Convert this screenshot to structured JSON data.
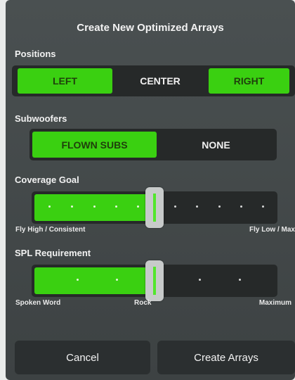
{
  "dialog": {
    "title": "Create New Optimized Arrays"
  },
  "positions": {
    "label": "Positions",
    "options": [
      {
        "label": "LEFT",
        "selected": true
      },
      {
        "label": "CENTER",
        "selected": false
      },
      {
        "label": "RIGHT",
        "selected": true
      }
    ]
  },
  "subwoofers": {
    "label": "Subwoofers",
    "options": [
      {
        "label": "FLOWN SUBS",
        "selected": true
      },
      {
        "label": "NONE",
        "selected": false
      }
    ]
  },
  "coverage_goal": {
    "label": "Coverage Goal",
    "value_fraction": 0.5,
    "min_label": "Fly High / Consistent",
    "max_label": "Fly Low / Max"
  },
  "spl_requirement": {
    "label": "SPL Requirement",
    "value_fraction": 0.5,
    "min_label": "Spoken Word",
    "mid_label": "Rock",
    "max_label": "Maximum"
  },
  "buttons": {
    "cancel": "Cancel",
    "create": "Create Arrays"
  },
  "colors": {
    "accent": "#3ad011",
    "panel": "#44494a",
    "control_bg": "#262929"
  }
}
